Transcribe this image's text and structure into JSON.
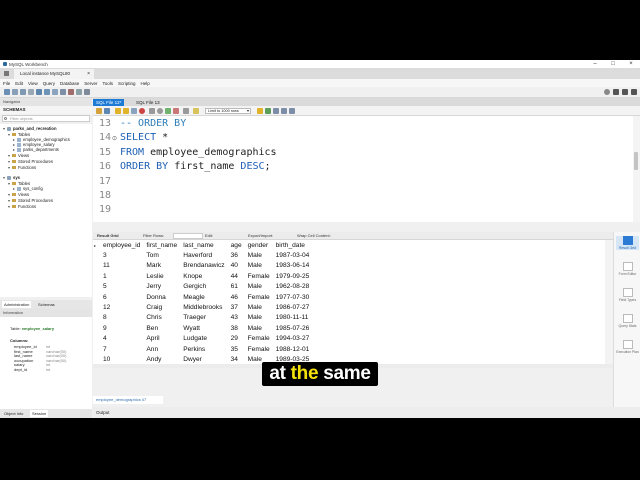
{
  "app_title": "MySQL Workbench",
  "connection_tab": "Local instance MySQL80",
  "menu": [
    "File",
    "Edit",
    "View",
    "Query",
    "Database",
    "Server",
    "Tools",
    "Scripting",
    "Help"
  ],
  "navigator": {
    "header": "Navigator",
    "schemas_label": "SCHEMAS",
    "filter_placeholder": "Filter objects",
    "tree": [
      {
        "label": "parks_and_recreation",
        "level": 0,
        "type": "db"
      },
      {
        "label": "Tables",
        "level": 1,
        "type": "folder"
      },
      {
        "label": "employee_demographics",
        "level": 2,
        "type": "table"
      },
      {
        "label": "employee_salary",
        "level": 2,
        "type": "table"
      },
      {
        "label": "parks_departments",
        "level": 2,
        "type": "table"
      },
      {
        "label": "Views",
        "level": 1,
        "type": "folder"
      },
      {
        "label": "Stored Procedures",
        "level": 1,
        "type": "folder"
      },
      {
        "label": "Functions",
        "level": 1,
        "type": "folder"
      },
      {
        "label": "sys",
        "level": 0,
        "type": "db"
      },
      {
        "label": "Tables",
        "level": 1,
        "type": "folder"
      },
      {
        "label": "sys_config",
        "level": 2,
        "type": "table"
      },
      {
        "label": "Views",
        "level": 1,
        "type": "folder"
      },
      {
        "label": "Stored Procedures",
        "level": 1,
        "type": "folder"
      },
      {
        "label": "Functions",
        "level": 1,
        "type": "folder"
      }
    ],
    "tabs": [
      "Administration",
      "Schemas"
    ],
    "info_header": "Information",
    "info": {
      "table_label": "Table:",
      "table_name": "employee_salary",
      "columns_label": "Columns:",
      "columns": [
        {
          "name": "employee_id",
          "type": "int"
        },
        {
          "name": "first_name",
          "type": "varchar(50)"
        },
        {
          "name": "last_name",
          "type": "varchar(50)"
        },
        {
          "name": "occupation",
          "type": "varchar(50)"
        },
        {
          "name": "salary",
          "type": "int"
        },
        {
          "name": "dept_id",
          "type": "int"
        }
      ]
    },
    "bottom_tabs": [
      "Object Info",
      "Session"
    ]
  },
  "editor": {
    "tabs": [
      "SQL File 12*",
      "SQL File 13"
    ],
    "limit_select": "Limit to 1000 rows",
    "lines": [
      {
        "num": "13",
        "parts": [
          {
            "t": "-- ORDER BY",
            "c": "cmt"
          }
        ]
      },
      {
        "num": "14",
        "fold": "⊙",
        "parts": [
          {
            "t": "SELECT",
            "c": "kw"
          },
          {
            "t": " *",
            "c": ""
          }
        ]
      },
      {
        "num": "15",
        "parts": [
          {
            "t": "FROM",
            "c": "kw"
          },
          {
            "t": " employee_demographics",
            "c": ""
          }
        ]
      },
      {
        "num": "16",
        "parts": [
          {
            "t": "ORDER BY",
            "c": "kw"
          },
          {
            "t": " first_name ",
            "c": ""
          },
          {
            "t": "DESC",
            "c": "kw"
          },
          {
            "t": ";",
            "c": ""
          }
        ]
      },
      {
        "num": "17",
        "parts": []
      },
      {
        "num": "18",
        "parts": []
      },
      {
        "num": "19",
        "parts": []
      }
    ]
  },
  "result": {
    "toolbar": {
      "grid_label": "Result Grid",
      "filter_label": "Filter Rows:",
      "edit_label": "Edit:",
      "export_label": "Export/Import:",
      "wrap_label": "Wrap Cell Content:"
    },
    "columns": [
      "employee_id",
      "first_name",
      "last_name",
      "age",
      "gender",
      "birth_date"
    ],
    "rows": [
      [
        "3",
        "Tom",
        "Haverford",
        "36",
        "Male",
        "1987-03-04"
      ],
      [
        "11",
        "Mark",
        "Brendanawicz",
        "40",
        "Male",
        "1983-06-14"
      ],
      [
        "1",
        "Leslie",
        "Knope",
        "44",
        "Female",
        "1979-09-25"
      ],
      [
        "5",
        "Jerry",
        "Gergich",
        "61",
        "Male",
        "1962-08-28"
      ],
      [
        "6",
        "Donna",
        "Meagle",
        "46",
        "Female",
        "1977-07-30"
      ],
      [
        "12",
        "Craig",
        "Middlebrooks",
        "37",
        "Male",
        "1986-07-27"
      ],
      [
        "8",
        "Chris",
        "Traeger",
        "43",
        "Male",
        "1980-11-11"
      ],
      [
        "9",
        "Ben",
        "Wyatt",
        "38",
        "Male",
        "1985-07-26"
      ],
      [
        "4",
        "April",
        "Ludgate",
        "29",
        "Female",
        "1994-03-27"
      ],
      [
        "7",
        "Ann",
        "Perkins",
        "35",
        "Female",
        "1988-12-01"
      ],
      [
        "10",
        "Andy",
        "Dwyer",
        "34",
        "Male",
        "1989-03-25"
      ]
    ],
    "result_tab": "employee_demographics 47",
    "side_panel": [
      "Result Grid",
      "Form Editor",
      "Field Types",
      "Query Stats",
      "Execution Plan"
    ]
  },
  "output_header": "Output",
  "caption": {
    "pre": "at ",
    "highlight": "the",
    "post": " same"
  }
}
